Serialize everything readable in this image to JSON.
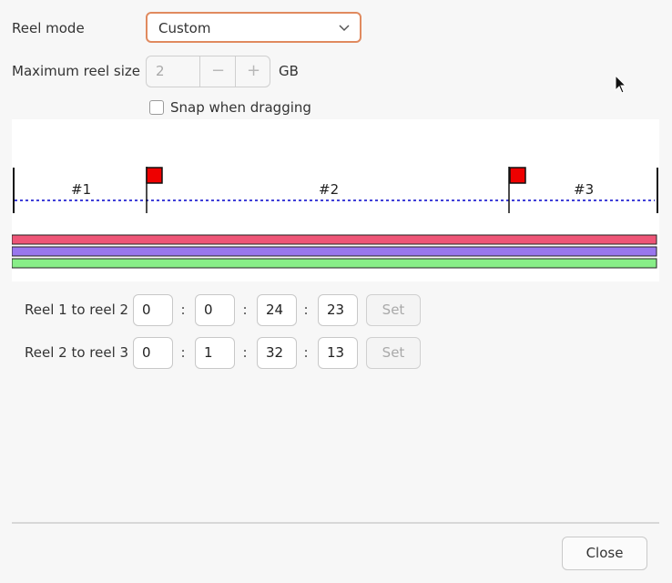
{
  "reel_mode": {
    "label": "Reel mode",
    "value": "Custom"
  },
  "max_reel_size": {
    "label": "Maximum reel size",
    "value": "2",
    "minus": "−",
    "plus": "+",
    "unit": "GB"
  },
  "snap": {
    "label": "Snap when dragging",
    "checked": false
  },
  "timeline": {
    "reels": [
      "#1",
      "#2",
      "#3"
    ],
    "colors": {
      "dash": "#0000cc",
      "flag": "#ee0000",
      "track_pink": "#ee5577",
      "track_purple": "#9977ee",
      "track_green": "#88ee88"
    }
  },
  "reel_boundaries": [
    {
      "label": "Reel 1 to reel 2",
      "h": "0",
      "m": "0",
      "s": "24",
      "f": "23",
      "button": "Set"
    },
    {
      "label": "Reel 2 to reel 3",
      "h": "0",
      "m": "1",
      "s": "32",
      "f": "13",
      "button": "Set"
    }
  ],
  "separator": ":",
  "close_button": "Close"
}
